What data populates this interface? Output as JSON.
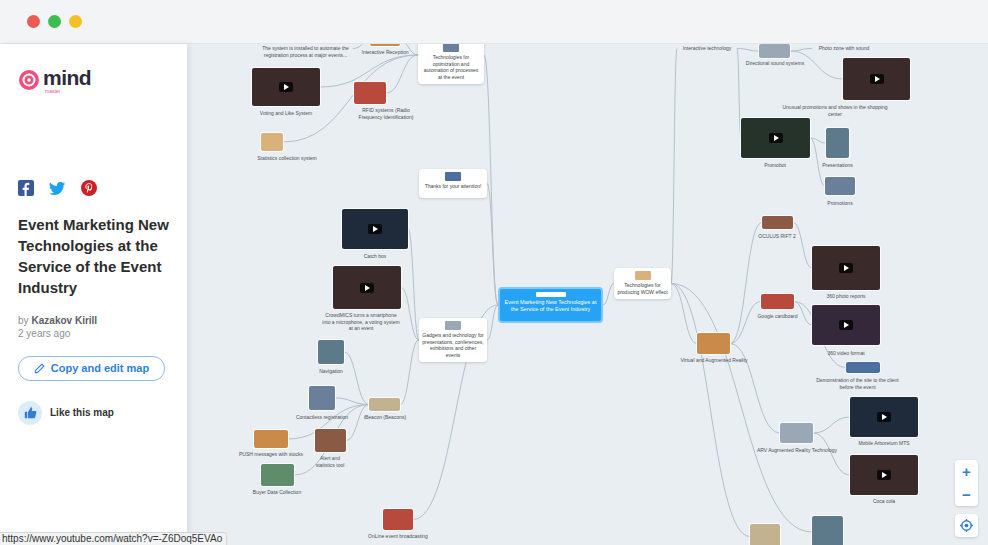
{
  "window": {
    "controls": [
      {
        "color": "#ec5a52"
      },
      {
        "color": "#3dbd4f"
      },
      {
        "color": "#f4c125"
      }
    ]
  },
  "sidebar": {
    "logo": {
      "word": "mind",
      "sub": "master"
    },
    "title": "Event Marketing New Technologies at the Service of the Event Industry",
    "author_prefix": "by",
    "author": "Kazakov Kirill",
    "time": "2 years ago",
    "copy_button": "Copy and edit map",
    "like_button": "Like this map"
  },
  "map": {
    "root": {
      "text": "Event Marketing New Technologies at the Service of the Event Industry"
    },
    "branches": [
      {
        "text": "Technologies for optimization and automation of processes at the event",
        "kind": "box",
        "children": [
          {
            "text": "Interactive Reception",
            "kind": "picture",
            "children": [
              {
                "text": "The system is installed to automate the registration process at major events...",
                "kind": "text"
              }
            ]
          },
          {
            "text": "Voting and Like System",
            "kind": "video"
          },
          {
            "text": "RFID systems (Radio Frequency Identification)",
            "kind": "picture"
          },
          {
            "text": "Statistics collection system",
            "kind": "picture"
          }
        ]
      },
      {
        "text": "Thanks for your attention!",
        "kind": "box"
      },
      {
        "text": "Gadgets and technology for presentations, conferences, exhibitions and other events",
        "kind": "box",
        "children": [
          {
            "text": "Catch box",
            "kind": "video"
          },
          {
            "text": "CrowdMICS turns a smartphone into a microphone, a voting system at an event",
            "kind": "video"
          },
          {
            "text": "iBeacon (Beacons)",
            "kind": "picture",
            "children": [
              {
                "text": "Navigation",
                "kind": "picture"
              },
              {
                "text": "Contactless registration",
                "kind": "picture"
              },
              {
                "text": "PUSH messages with stocks",
                "kind": "picture"
              },
              {
                "text": "Alert and statistics tool",
                "kind": "picture"
              },
              {
                "text": "Buyer Data Collection",
                "kind": "picture"
              }
            ]
          }
        ]
      },
      {
        "text": "OnLine event broadcasting",
        "kind": "picture"
      },
      {
        "text": "Technologies for producing WOW effect",
        "kind": "box",
        "children": [
          {
            "text": "Interactive technology",
            "kind": "text",
            "children": [
              {
                "text": "Directional sound systems",
                "kind": "picture",
                "children": [
                  {
                    "text": "Photo zone with sound",
                    "kind": "text"
                  },
                  {
                    "text": "Unusual promotions and shows in the shopping center",
                    "kind": "video"
                  }
                ]
              },
              {
                "text": "Promobot",
                "kind": "video",
                "children": [
                  {
                    "text": "Presentations",
                    "kind": "picture"
                  },
                  {
                    "text": "Promotions",
                    "kind": "picture"
                  }
                ]
              }
            ]
          },
          {
            "text": "Virtual and Augmented Reality",
            "kind": "picture",
            "children": [
              {
                "text": "OCULUS RIFT 2",
                "kind": "picture",
                "children": [
                  {
                    "text": "360 photo reports",
                    "kind": "video"
                  }
                ]
              },
              {
                "text": "Google cardboard",
                "kind": "picture",
                "children": [
                  {
                    "text": "360 video format",
                    "kind": "video"
                  },
                  {
                    "text": "Demonstration of the site to the client before the event",
                    "kind": "picture"
                  }
                ]
              },
              {
                "text": "ARV Augmented Reality Technology",
                "kind": "picture",
                "children": [
                  {
                    "text": "Mobile Arboretum MTS",
                    "kind": "video"
                  },
                  {
                    "text": "Coca cola",
                    "kind": "video"
                  }
                ]
              }
            ]
          },
          {
            "kind": "picture"
          },
          {
            "kind": "picture"
          }
        ]
      }
    ]
  },
  "zoom": {
    "in": "+",
    "out": "−"
  },
  "status_bar": {
    "url": "https://www.youtube.com/watch?v=-Z6Doq5EVAo"
  }
}
